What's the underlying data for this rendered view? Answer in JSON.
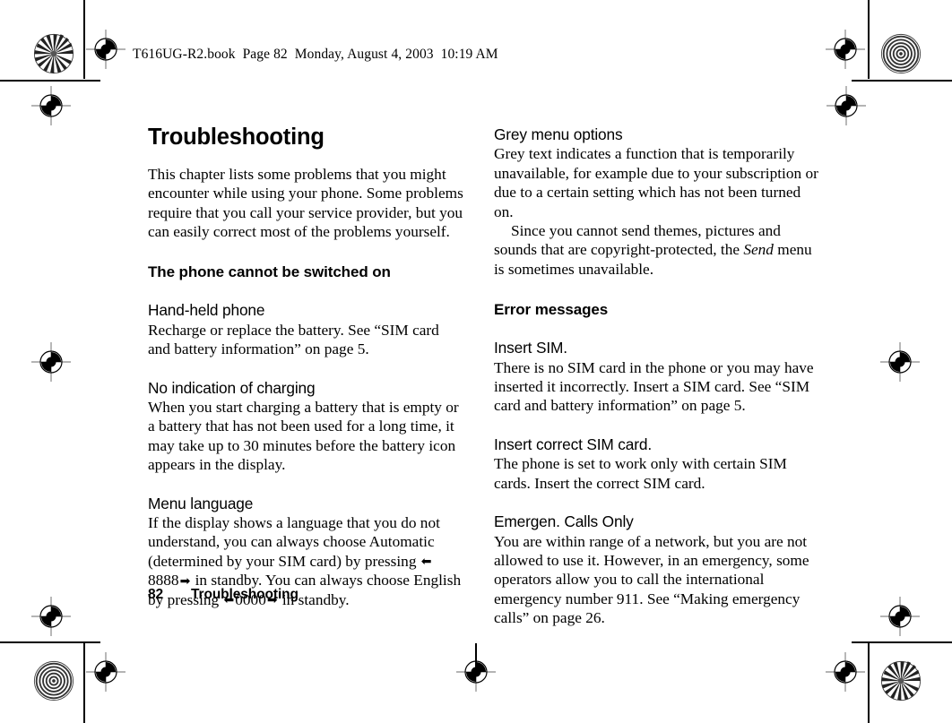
{
  "document": {
    "book_header": "T616UG-R2.book  Page 82  Monday, August 4, 2003  10:19 AM",
    "footer_page_number": "82",
    "footer_title": "Troubleshooting",
    "ink_color": "#000000",
    "paper_color": "#ffffff"
  },
  "page": {
    "title": "Troubleshooting",
    "intro": "This chapter lists some problems that you might encounter while using your phone. Some problems require that you call your service provider, but you can easily correct most of the problems yourself."
  },
  "left_column": {
    "section_heading": "The phone cannot be switched on",
    "entries": [
      {
        "heading": "Hand-held phone",
        "body": "Recharge or replace the battery. See “SIM card and battery information” on page 5."
      },
      {
        "heading": "No indication of charging",
        "body": "When you start charging a battery that is empty or a battery that has not been used for a long time, it may take up to 30 minutes before the battery icon appears in the display."
      },
      {
        "heading": "Menu language",
        "body_part_1": "If the display shows a language that you do not understand, you can always choose Automatic (determined by your SIM card) by pressing ",
        "code_1": "8888",
        "body_part_2": " in standby. You can always choose English by pressing ",
        "code_2": "0000",
        "body_part_3": " in standby.",
        "arrow_left": "⬅",
        "arrow_right": "➡"
      }
    ]
  },
  "right_column": {
    "grey_menu": {
      "heading": "Grey menu options",
      "body_1": "Grey text indicates a function that is temporarily unavailable, for example due to your subscription or due to a certain setting which has not been turned on.",
      "body_2_part_1": "Since you cannot send themes, pictures and sounds that are copyright-protected, the ",
      "body_2_italic": "Send",
      "body_2_part_2": " menu is sometimes unavailable."
    },
    "section_heading": "Error messages",
    "entries": [
      {
        "heading": "Insert SIM.",
        "body": "There is no SIM card in the phone or you may have inserted it incorrectly. Insert a SIM card. See “SIM card and battery information” on page 5."
      },
      {
        "heading": "Insert correct SIM card.",
        "body": "The phone is set to work only with certain SIM cards. Insert the correct SIM card."
      },
      {
        "heading": "Emergen. Calls Only",
        "body": "You are within range of a network, but you are not allowed to use it. However, in an emergency, some operators allow you to call the international emergency number 911. See “Making emergency calls” on page 26."
      }
    ],
    "margin_icon": "phone-outline-icon"
  }
}
